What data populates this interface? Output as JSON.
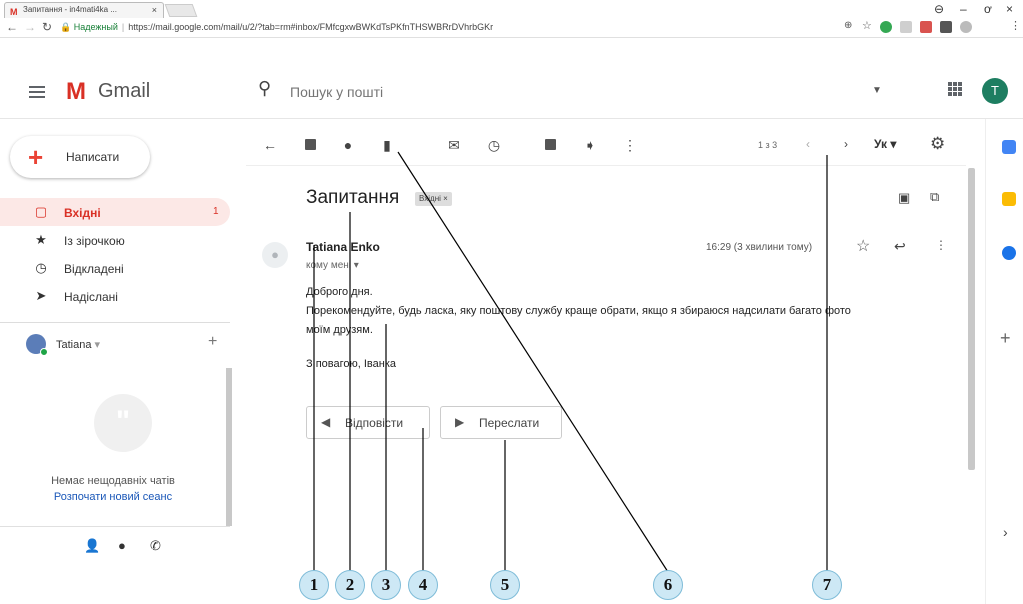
{
  "browser": {
    "tab_title": "Запитання - in4mati4ka ...",
    "tab_close": "×",
    "secure_label": "Надежный",
    "url": "https://mail.google.com/mail/u/2/?tab=rm#inbox/FMfcgxwBWKdTsPKfnTHSWBRrDVhrbGKr",
    "min": "–",
    "max": "ơ",
    "close": "×"
  },
  "header": {
    "logo_text": "Gmail",
    "search_placeholder": "Пошук у пошті",
    "avatar_letter": "T"
  },
  "sidebar": {
    "compose_label": "Написати",
    "items": [
      {
        "label": "Вхідні",
        "count": "1",
        "icon": "inbox-icon"
      },
      {
        "label": "Із зірочкою",
        "count": "",
        "icon": "star-icon"
      },
      {
        "label": "Відкладені",
        "count": "",
        "icon": "clock-icon"
      },
      {
        "label": "Надіслані",
        "count": "",
        "icon": "send-icon"
      }
    ],
    "user_name": "Tatiana",
    "user_caret": "▾",
    "no_chats": "Немає нещодавніх чатів",
    "new_session": "Розпочати новий сеанс"
  },
  "toolbar": {
    "pager": "1 з 3",
    "lang": "Ук ▾"
  },
  "message": {
    "subject": "Запитання",
    "label_chip": "Вхідні ×",
    "sender": "Tatiana Enko",
    "to_me": "кому мені ▾",
    "time": "16:29 (3 хвилини тому)",
    "body": [
      "Доброго дня.",
      "Порекомендуйте, будь ласка, яку поштову службу краще обрати, якщо я збираюся надсилати багато фото",
      "моїм друзям.",
      "З повагою, Іванка"
    ],
    "reply_label": "Відповісти",
    "forward_label": "Переслати"
  },
  "callouts": [
    "1",
    "2",
    "3",
    "4",
    "5",
    "6",
    "7"
  ]
}
